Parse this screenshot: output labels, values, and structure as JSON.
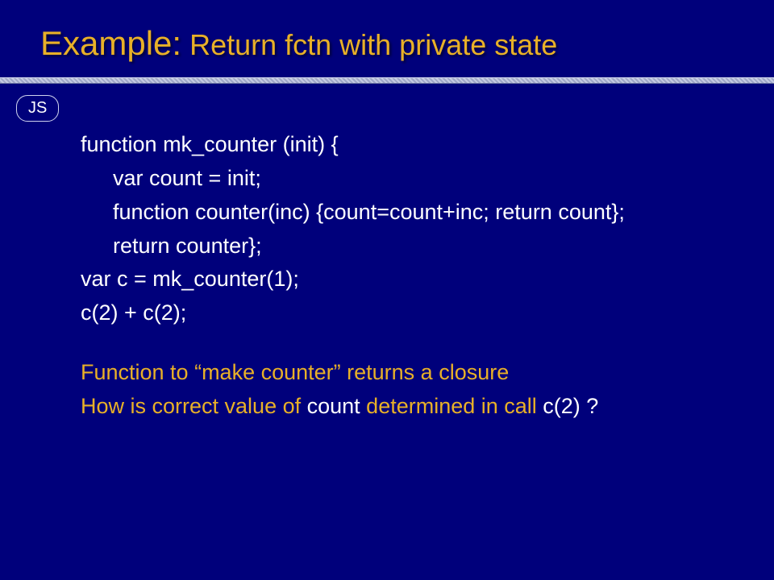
{
  "title": {
    "part1": "Example:",
    "part2": " Return fctn with private state"
  },
  "badge": "JS",
  "code": {
    "l1": "function mk_counter (init) {",
    "l2": "var count = init;",
    "l3": "function counter(inc) {count=count+inc; return count};",
    "l4": "return counter};",
    "l5": "var c  = mk_counter(1);",
    "l6": "c(2) + c(2);"
  },
  "notes": {
    "line1": "Function to “make counter” returns a closure",
    "line2a": "How is correct value of ",
    "line2b": "count",
    "line2c": " determined in call ",
    "line2d": "c(2) ?"
  }
}
